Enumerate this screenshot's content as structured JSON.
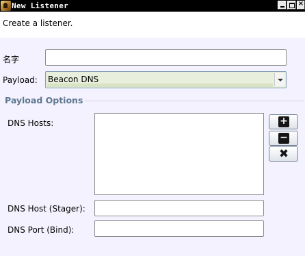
{
  "window": {
    "title": "New Listener",
    "buttons": [
      "minimize",
      "maximize",
      "close"
    ]
  },
  "intro": {
    "text": "Create a listener."
  },
  "form": {
    "name": {
      "label": "名字",
      "value": ""
    },
    "payload": {
      "label": "Payload:",
      "selected": "Beacon DNS"
    }
  },
  "payload_options": {
    "title": "Payload Options",
    "dns_hosts": {
      "label": "DNS Hosts:",
      "items": []
    },
    "host_buttons": [
      {
        "name": "add",
        "icon": "plus-icon"
      },
      {
        "name": "remove",
        "icon": "minus-icon"
      },
      {
        "name": "clear",
        "icon": "x-icon"
      }
    ],
    "dns_host_stager": {
      "label": "DNS Host (Stager):",
      "value": ""
    },
    "dns_port_bind": {
      "label": "DNS Port (Bind):",
      "value": ""
    }
  },
  "colors": {
    "titlebar": "#000000",
    "form_background": "#f3f2fe",
    "section_title": "#5e7790",
    "payload_select_bg": "#e8efdc"
  }
}
